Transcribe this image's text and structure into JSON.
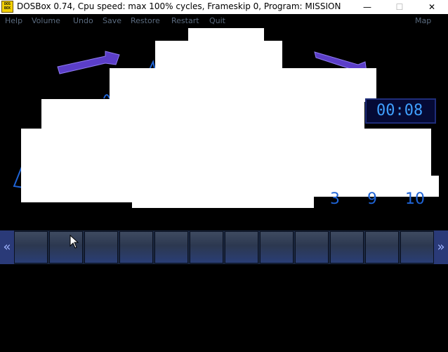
{
  "window": {
    "icon_text": "DOS\nBOX",
    "title": "DOSBox 0.74, Cpu speed: max 100% cycles, Frameskip  0, Program:  MISSION",
    "minimize": "—",
    "maximize": "☐",
    "close": "✕"
  },
  "menu": {
    "items": [
      "Help",
      "Volume",
      "Undo",
      "Save",
      "Restore",
      "Restart",
      "Quit"
    ],
    "right": "Map"
  },
  "game": {
    "timer": "00:08",
    "numbers": [
      "3",
      "9",
      "10"
    ],
    "colors": {
      "accent": "#3fa0ff",
      "purple": "#5b3ec8",
      "toolbar": "#2a3e76"
    }
  },
  "toolbar": {
    "left_arrow": "«",
    "right_arrow": "»",
    "slot_count": 12
  }
}
